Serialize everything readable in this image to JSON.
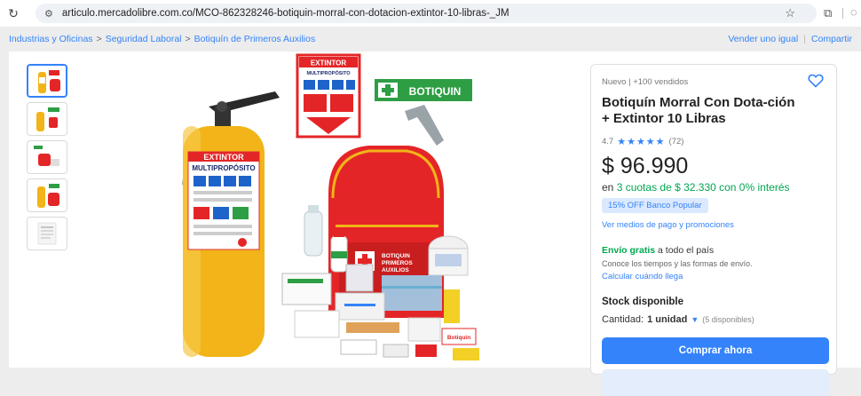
{
  "browser": {
    "url": "articulo.mercadolibre.com.co/MCO-862328246-botiquin-morral-con-dotacion-extintor-10-libras-_JM"
  },
  "breadcrumb": {
    "items": [
      "Industrias y Oficinas",
      "Seguridad Laboral",
      "Botiquín de Primeros Auxilios"
    ],
    "separator": ">",
    "sell_label": "Vender uno igual",
    "share_label": "Compartir"
  },
  "product_image": {
    "extinguisher_label": "EXTINTOR",
    "extinguisher_subtitle": "MULTIPROPÓSITO",
    "sign_extintor_title": "EXTINTOR",
    "sign_extintor_subtitle": "MULTIPROPÓSITO",
    "sign_botiquin": "BOTIQUIN",
    "backpack_label_1": "BOTIQUIN",
    "backpack_label_2": "PRIMEROS",
    "backpack_label_3": "AUXILIOS",
    "kit_label": "Botiquin"
  },
  "product": {
    "condition": "Nuevo",
    "sold": "+100 vendidos",
    "title": "Botiquín Morral Con Dota-ción + Extintor 10 Libras",
    "rating": "4.7",
    "stars": "★★★★★",
    "reviews": "(72)",
    "price": "$ 96.990",
    "installments_prefix": "en",
    "installments_value": "3 cuotas de $ 32.330 con 0% interés",
    "promo": "15% OFF Banco Popular",
    "payment_link": "Ver medios de pago y promociones",
    "shipping_free": "Envío gratis",
    "shipping_rest": "a todo el país",
    "shipping_info": "Conoce los tiempos y las formas de envío.",
    "shipping_calc": "Calcular cuándo llega",
    "stock": "Stock disponible",
    "quantity_label": "Cantidad:",
    "quantity_value": "1 unidad",
    "quantity_available": "(5 disponibles)",
    "buy_button": "Comprar ahora"
  },
  "colors": {
    "accent": "#3483fa",
    "green": "#00a650",
    "extinguisher": "#f2b418",
    "red": "#e42527"
  }
}
